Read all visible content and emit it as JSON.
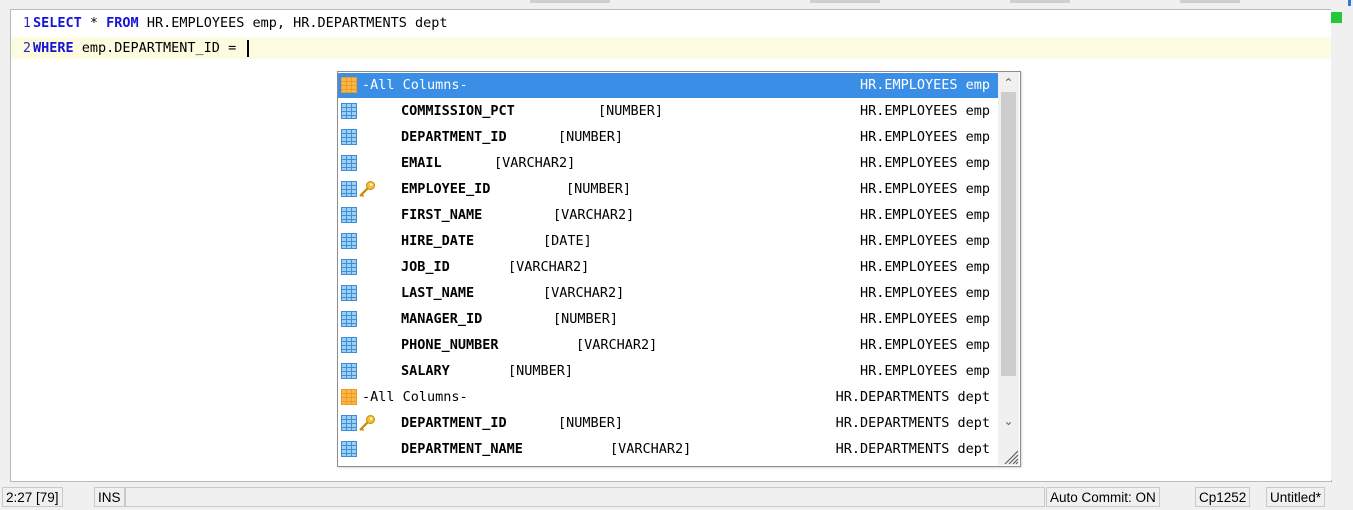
{
  "editor": {
    "lines": [
      {
        "number": "1",
        "keyword1": "SELECT",
        "text1": " * ",
        "keyword2": "FROM",
        "text2": " HR.EMPLOYEES emp, HR.DEPARTMENTS dept"
      },
      {
        "number": "2",
        "keyword1": "WHERE",
        "text1": " emp.DEPARTMENT_ID = "
      }
    ]
  },
  "completion": {
    "rows": [
      {
        "header": true,
        "name": "-All Columns-",
        "type": "",
        "owner": "HR.EMPLOYEES emp",
        "selected": true,
        "key": false
      },
      {
        "header": false,
        "name": "COMMISSION_PCT",
        "type": "[NUMBER]",
        "owner": "HR.EMPLOYEES emp",
        "key": false
      },
      {
        "header": false,
        "name": "DEPARTMENT_ID",
        "type": "[NUMBER]",
        "owner": "HR.EMPLOYEES emp",
        "key": false
      },
      {
        "header": false,
        "name": "EMAIL",
        "type": "[VARCHAR2]",
        "owner": "HR.EMPLOYEES emp",
        "key": false
      },
      {
        "header": false,
        "name": "EMPLOYEE_ID",
        "type": "[NUMBER]",
        "owner": "HR.EMPLOYEES emp",
        "key": true
      },
      {
        "header": false,
        "name": "FIRST_NAME",
        "type": "[VARCHAR2]",
        "owner": "HR.EMPLOYEES emp",
        "key": false
      },
      {
        "header": false,
        "name": "HIRE_DATE",
        "type": "[DATE]",
        "owner": "HR.EMPLOYEES emp",
        "key": false
      },
      {
        "header": false,
        "name": "JOB_ID",
        "type": "[VARCHAR2]",
        "owner": "HR.EMPLOYEES emp",
        "key": false
      },
      {
        "header": false,
        "name": "LAST_NAME",
        "type": "[VARCHAR2]",
        "owner": "HR.EMPLOYEES emp",
        "key": false
      },
      {
        "header": false,
        "name": "MANAGER_ID",
        "type": "[NUMBER]",
        "owner": "HR.EMPLOYEES emp",
        "key": false
      },
      {
        "header": false,
        "name": "PHONE_NUMBER",
        "type": "[VARCHAR2]",
        "owner": "HR.EMPLOYEES emp",
        "key": false
      },
      {
        "header": false,
        "name": "SALARY",
        "type": "[NUMBER]",
        "owner": "HR.EMPLOYEES emp",
        "key": false
      },
      {
        "header": true,
        "name": "-All Columns-",
        "type": "",
        "owner": "HR.DEPARTMENTS dept",
        "key": false
      },
      {
        "header": false,
        "name": "DEPARTMENT_ID",
        "type": "[NUMBER]",
        "owner": "HR.DEPARTMENTS dept",
        "key": true
      },
      {
        "header": false,
        "name": "DEPARTMENT_NAME",
        "type": "[VARCHAR2]",
        "owner": "HR.DEPARTMENTS dept",
        "key": false
      }
    ],
    "scroll_up": "⌃",
    "scroll_down": "⌄"
  },
  "statusbar": {
    "position": "2:27 [79]",
    "mode": "INS",
    "autocommit": "Auto Commit: ON",
    "encoding": "Cp1252",
    "document": "Untitled*"
  },
  "colors": {
    "selection": "#3a8ee6",
    "keyword": "#1515d8",
    "current_line": "#fdfbe0",
    "status_ok": "#22c83a"
  },
  "icons": {
    "column": "column-grid-icon",
    "all_columns": "all-columns-grid-icon",
    "primary_key": "key-icon"
  }
}
